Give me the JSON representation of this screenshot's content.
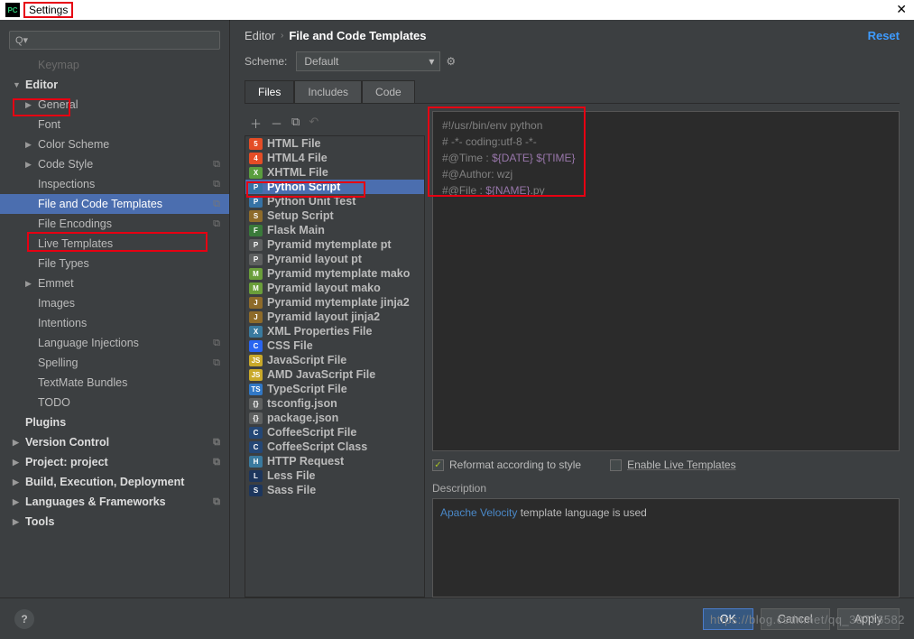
{
  "title": "Settings",
  "breadcrumb": {
    "a": "Editor",
    "b": "File and Code Templates"
  },
  "reset": "Reset",
  "scheme": {
    "label": "Scheme:",
    "value": "Default"
  },
  "tabs": {
    "files": "Files",
    "includes": "Includes",
    "code": "Code"
  },
  "search_placeholder": "Q▾",
  "sidebar": [
    {
      "label": "Keymap",
      "depth": 1,
      "arrow": "none",
      "dim": true
    },
    {
      "label": "Editor",
      "depth": 0,
      "arrow": "down",
      "bold": true
    },
    {
      "label": "General",
      "depth": 1,
      "arrow": "right"
    },
    {
      "label": "Font",
      "depth": 1,
      "arrow": "none"
    },
    {
      "label": "Color Scheme",
      "depth": 1,
      "arrow": "right"
    },
    {
      "label": "Code Style",
      "depth": 1,
      "arrow": "right",
      "copy": true
    },
    {
      "label": "Inspections",
      "depth": 1,
      "arrow": "none",
      "copy": true
    },
    {
      "label": "File and Code Templates",
      "depth": 1,
      "arrow": "none",
      "copy": true,
      "selected": true
    },
    {
      "label": "File Encodings",
      "depth": 1,
      "arrow": "none",
      "copy": true
    },
    {
      "label": "Live Templates",
      "depth": 1,
      "arrow": "none"
    },
    {
      "label": "File Types",
      "depth": 1,
      "arrow": "none"
    },
    {
      "label": "Emmet",
      "depth": 1,
      "arrow": "right"
    },
    {
      "label": "Images",
      "depth": 1,
      "arrow": "none"
    },
    {
      "label": "Intentions",
      "depth": 1,
      "arrow": "none"
    },
    {
      "label": "Language Injections",
      "depth": 1,
      "arrow": "none",
      "copy": true
    },
    {
      "label": "Spelling",
      "depth": 1,
      "arrow": "none",
      "copy": true
    },
    {
      "label": "TextMate Bundles",
      "depth": 1,
      "arrow": "none"
    },
    {
      "label": "TODO",
      "depth": 1,
      "arrow": "none"
    },
    {
      "label": "Plugins",
      "depth": 0,
      "arrow": "none",
      "bold": true
    },
    {
      "label": "Version Control",
      "depth": 0,
      "arrow": "right",
      "bold": true,
      "copy": true
    },
    {
      "label": "Project: project",
      "depth": 0,
      "arrow": "right",
      "bold": true,
      "copy": true
    },
    {
      "label": "Build, Execution, Deployment",
      "depth": 0,
      "arrow": "right",
      "bold": true
    },
    {
      "label": "Languages & Frameworks",
      "depth": 0,
      "arrow": "right",
      "bold": true,
      "copy": true
    },
    {
      "label": "Tools",
      "depth": 0,
      "arrow": "right",
      "bold": true
    }
  ],
  "filelist": [
    {
      "label": "HTML File",
      "ic": "ic-html",
      "t": "5"
    },
    {
      "label": "HTML4 File",
      "ic": "ic-html4",
      "t": "4"
    },
    {
      "label": "XHTML File",
      "ic": "ic-xhtml",
      "t": "X"
    },
    {
      "label": "Python Script",
      "ic": "ic-py",
      "t": "P",
      "selected": true
    },
    {
      "label": "Python Unit Test",
      "ic": "ic-py",
      "t": "P"
    },
    {
      "label": "Setup Script",
      "ic": "ic-setup",
      "t": "S"
    },
    {
      "label": "Flask Main",
      "ic": "ic-flask",
      "t": "F"
    },
    {
      "label": "Pyramid mytemplate pt",
      "ic": "ic-ft",
      "t": "P"
    },
    {
      "label": "Pyramid layout pt",
      "ic": "ic-ft",
      "t": "P"
    },
    {
      "label": "Pyramid mytemplate mako",
      "ic": "ic-mk",
      "t": "M"
    },
    {
      "label": "Pyramid layout mako",
      "ic": "ic-mk",
      "t": "M"
    },
    {
      "label": "Pyramid mytemplate jinja2",
      "ic": "ic-jn",
      "t": "J"
    },
    {
      "label": "Pyramid layout jinja2",
      "ic": "ic-jn",
      "t": "J"
    },
    {
      "label": "XML Properties File",
      "ic": "ic-xml",
      "t": "X"
    },
    {
      "label": "CSS File",
      "ic": "ic-css",
      "t": "C"
    },
    {
      "label": "JavaScript File",
      "ic": "ic-js",
      "t": "JS"
    },
    {
      "label": "AMD JavaScript File",
      "ic": "ic-js",
      "t": "JS"
    },
    {
      "label": "TypeScript File",
      "ic": "ic-ts",
      "t": "TS"
    },
    {
      "label": "tsconfig.json",
      "ic": "ic-json",
      "t": "{}"
    },
    {
      "label": "package.json",
      "ic": "ic-json",
      "t": "{}"
    },
    {
      "label": "CoffeeScript File",
      "ic": "ic-cf",
      "t": "C"
    },
    {
      "label": "CoffeeScript Class",
      "ic": "ic-cf",
      "t": "C"
    },
    {
      "label": "HTTP Request",
      "ic": "ic-http",
      "t": "H"
    },
    {
      "label": "Less File",
      "ic": "ic-less",
      "t": "L"
    },
    {
      "label": "Sass File",
      "ic": "ic-less",
      "t": "S"
    }
  ],
  "code": {
    "l1": "#!/usr/bin/env python",
    "l2": "# -*- coding:utf-8 -*-",
    "l3a": "#@Time  : ",
    "l3b": "${DATE} ${TIME}",
    "l4": "#@Author: wzj",
    "l5a": "#@File  : ",
    "l5b": "${NAME}",
    "l5c": ".py"
  },
  "opts": {
    "reformat": "Reformat according to style",
    "enable_lt": "Enable Live Templates"
  },
  "desc": {
    "label": "Description",
    "link": "Apache Velocity",
    "rest": " template language is used"
  },
  "buttons": {
    "ok": "OK",
    "cancel": "Cancel",
    "apply": "Apply"
  },
  "watermark": "https://blog.csdn.net/qq_38776582"
}
